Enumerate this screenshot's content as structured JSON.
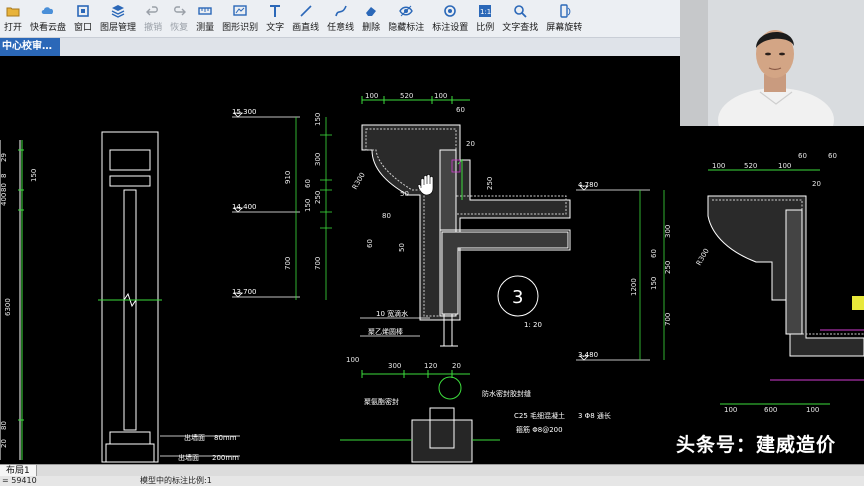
{
  "toolbar": {
    "items": [
      {
        "label": "打开",
        "icon": "folder-icon",
        "enabled": true
      },
      {
        "label": "快看云盘",
        "icon": "cloud-icon",
        "enabled": true
      },
      {
        "label": "窗口",
        "icon": "window-icon",
        "enabled": true
      },
      {
        "label": "图层管理",
        "icon": "layers-icon",
        "enabled": true
      },
      {
        "label": "撤销",
        "icon": "undo-icon",
        "enabled": false
      },
      {
        "label": "恢复",
        "icon": "redo-icon",
        "enabled": false
      },
      {
        "label": "测量",
        "icon": "ruler-icon",
        "enabled": true
      },
      {
        "label": "图形识别",
        "icon": "shape-recognize-icon",
        "enabled": true
      },
      {
        "label": "文字",
        "icon": "text-icon",
        "enabled": true
      },
      {
        "label": "画直线",
        "icon": "line-icon",
        "enabled": true
      },
      {
        "label": "任意线",
        "icon": "freehand-icon",
        "enabled": true
      },
      {
        "label": "删除",
        "icon": "eraser-icon",
        "enabled": true
      },
      {
        "label": "隐藏标注",
        "icon": "eye-icon",
        "enabled": true
      },
      {
        "label": "标注设置",
        "icon": "annotation-settings-icon",
        "enabled": true
      },
      {
        "label": "比例",
        "icon": "scale-icon",
        "enabled": true
      },
      {
        "label": "文字查找",
        "icon": "text-search-icon",
        "enabled": true
      },
      {
        "label": "屏幕旋转",
        "icon": "rotate-screen-icon",
        "enabled": true
      }
    ]
  },
  "document_tab": {
    "label": "中心校审…"
  },
  "drawing": {
    "left_dims": [
      "29",
      "8",
      "80",
      "400",
      "150",
      "6300",
      "80",
      "20"
    ],
    "elevations": [
      "15.300",
      "14.400",
      "13.700",
      "4.780",
      "3.480"
    ],
    "mid_dims": [
      "150",
      "300",
      "910",
      "60",
      "150",
      "250",
      "700",
      "700"
    ],
    "detail_top_dims": [
      "100",
      "520",
      "100",
      "60",
      "20"
    ],
    "detail_side_dims": [
      "R300",
      "50",
      "250",
      "80",
      "50",
      "60"
    ],
    "detail_bottom_dims": [
      "100",
      "300",
      "120",
      "20"
    ],
    "right_top_dims": [
      "100",
      "520",
      "100",
      "60",
      "60",
      "20"
    ],
    "right_side_dims": [
      "R300",
      "1200",
      "300",
      "60",
      "150",
      "250",
      "700"
    ],
    "right_bottom_dims": [
      "100",
      "600",
      "100"
    ],
    "detail_number": "3",
    "detail_scale": "1: 20",
    "notes": {
      "drip": "10 宽滴水",
      "foam": "聚乙烯圆棒",
      "sealant": "聚氨酯密封",
      "waterproof": "防水密封胶封缝",
      "concrete": "C25 毛细混凝土",
      "rebar": "3 Φ8 通长",
      "stirrup": "箍筋 Φ8@200",
      "sill_label": "出墙面",
      "sill_value": "80mm",
      "base_label": "出墙面",
      "base_value": "200mm"
    }
  },
  "layout_tab": {
    "label": "布局1"
  },
  "status": {
    "coord": "= 59410",
    "message": "模型中的标注比例:1"
  },
  "watermark": "头条号：建威造价",
  "colors": {
    "accent": "#2b68b8",
    "cad_green": "#3ddc3d",
    "cad_white": "#ffffff",
    "cad_magenta": "#d23cd2",
    "cad_yellow": "#e8e83a"
  }
}
